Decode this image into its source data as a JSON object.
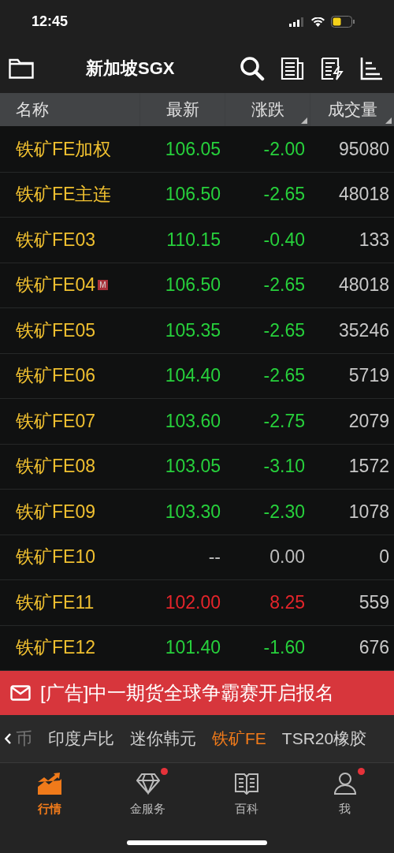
{
  "status_bar": {
    "time": "12:45"
  },
  "toolbar": {
    "title": "新加坡SGX"
  },
  "table": {
    "columns": [
      {
        "label": "名称",
        "sort_mark": false
      },
      {
        "label": "最新",
        "sort_mark": false
      },
      {
        "label": "涨跌",
        "sort_mark": true
      },
      {
        "label": "成交量",
        "sort_mark": true
      }
    ],
    "rows": [
      {
        "name": "铁矿FE加权",
        "badge": null,
        "last": "106.05",
        "change": "-2.00",
        "volume": "95080",
        "color": "#27d13c"
      },
      {
        "name": "铁矿FE主连",
        "badge": null,
        "last": "106.50",
        "change": "-2.65",
        "volume": "48018",
        "color": "#27d13c"
      },
      {
        "name": "铁矿FE03",
        "badge": null,
        "last": "110.15",
        "change": "-0.40",
        "volume": "133",
        "color": "#27d13c"
      },
      {
        "name": "铁矿FE04",
        "badge": "M",
        "last": "106.50",
        "change": "-2.65",
        "volume": "48018",
        "color": "#27d13c"
      },
      {
        "name": "铁矿FE05",
        "badge": null,
        "last": "105.35",
        "change": "-2.65",
        "volume": "35246",
        "color": "#27d13c"
      },
      {
        "name": "铁矿FE06",
        "badge": null,
        "last": "104.40",
        "change": "-2.65",
        "volume": "5719",
        "color": "#27d13c"
      },
      {
        "name": "铁矿FE07",
        "badge": null,
        "last": "103.60",
        "change": "-2.75",
        "volume": "2079",
        "color": "#27d13c"
      },
      {
        "name": "铁矿FE08",
        "badge": null,
        "last": "103.05",
        "change": "-3.10",
        "volume": "1572",
        "color": "#27d13c"
      },
      {
        "name": "铁矿FE09",
        "badge": null,
        "last": "103.30",
        "change": "-2.30",
        "volume": "1078",
        "color": "#27d13c"
      },
      {
        "name": "铁矿FE10",
        "badge": null,
        "last": "--",
        "change": "0.00",
        "volume": "0",
        "color": "#bdbdbd"
      },
      {
        "name": "铁矿FE11",
        "badge": null,
        "last": "102.00",
        "change": "8.25",
        "volume": "559",
        "color": "#e5252b"
      },
      {
        "name": "铁矿FE12",
        "badge": null,
        "last": "101.40",
        "change": "-1.60",
        "volume": "676",
        "color": "#27d13c"
      }
    ]
  },
  "ad_banner": {
    "text": "[广告]中一期货全球争霸赛开启报名"
  },
  "category_tabs": [
    {
      "label": "币",
      "selected": false,
      "cut": true
    },
    {
      "label": "印度卢比",
      "selected": false,
      "cut": false
    },
    {
      "label": "迷你韩元",
      "selected": false,
      "cut": false
    },
    {
      "label": "铁矿FE",
      "selected": true,
      "cut": false
    },
    {
      "label": "TSR20橡胶",
      "selected": false,
      "cut": false
    }
  ],
  "bottom_nav": [
    {
      "label": "行情",
      "kind": "chart",
      "selected": true,
      "dot": false
    },
    {
      "label": "金服务",
      "kind": "diamond",
      "selected": false,
      "dot": true
    },
    {
      "label": "百科",
      "kind": "book",
      "selected": false,
      "dot": false
    },
    {
      "label": "我",
      "kind": "person",
      "selected": false,
      "dot": true
    }
  ]
}
